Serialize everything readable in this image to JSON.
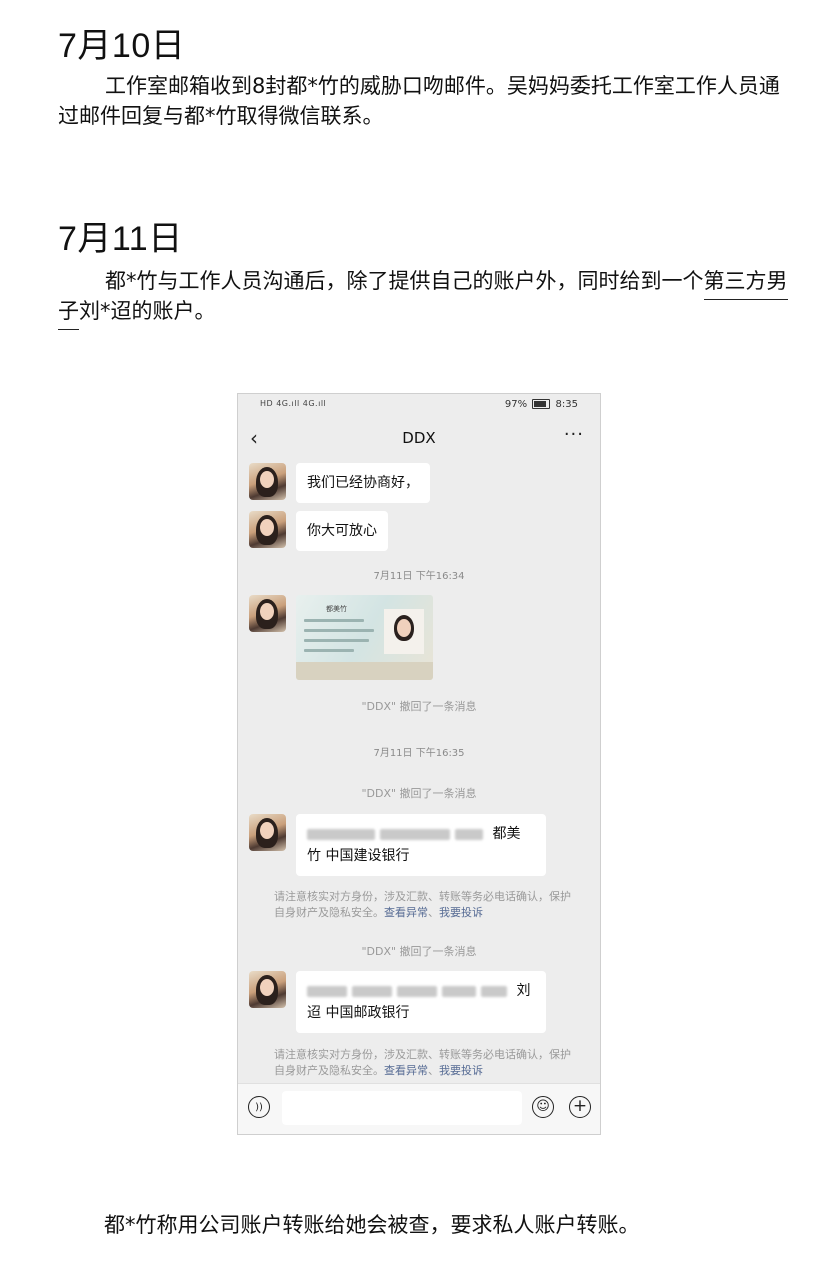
{
  "doc": {
    "date1": "7月10日",
    "para1": "工作室邮箱收到8封都*竹的威胁口吻邮件。吴妈妈委托工作室工作人员通过邮件回复与都*竹取得微信联系。",
    "date2": "7月11日",
    "para2_start": "都*竹与工作人员沟通后，除了提供自己的账户外，同时给到一个",
    "para2_underlined": "第三方男子",
    "para2_end": "刘*迢的账户。",
    "bottom_para": "都*竹称用公司账户转账给她会被查，要求私人账户转账。"
  },
  "phone": {
    "status": {
      "signal_text": "HD 4G.ıll 4G.ıll",
      "battery": "97%",
      "time": "8:35"
    },
    "nav": {
      "back_icon": "back-arrow-icon",
      "title": "DDX",
      "more_icon": "more-dots-icon"
    },
    "messages": [
      {
        "type": "text",
        "text": "我们已经协商好，"
      },
      {
        "type": "text",
        "text": "你大可放心"
      },
      {
        "type": "time",
        "text": "7月11日 下午16:34"
      },
      {
        "type": "image",
        "card_name": "都美竹"
      },
      {
        "type": "recall",
        "text": "\"DDX\" 撤回了一条消息"
      },
      {
        "type": "time",
        "text": "7月11日 下午16:35"
      },
      {
        "type": "recall",
        "text": "\"DDX\" 撤回了一条消息"
      },
      {
        "type": "account",
        "line1_end": "都美",
        "line2": "竹  中国建设银行"
      },
      {
        "type": "warning",
        "text": "请注意核实对方身份，涉及汇款、转账等务必电话确认，保护自身财产及隐私安全。",
        "link1": "查看异常",
        "link2": "我要投诉"
      },
      {
        "type": "recall",
        "text": "\"DDX\" 撤回了一条消息"
      },
      {
        "type": "account",
        "line1_end": "刘",
        "line2": "迢  中国邮政银行"
      },
      {
        "type": "warning",
        "text": "请注意核实对方身份，涉及汇款、转账等务必电话确认，保护自身财产及隐私安全。",
        "link1": "查看异常",
        "link2": "我要投诉"
      }
    ],
    "input_bar": {
      "voice_icon": "voice-icon",
      "emoji_icon": "emoji-icon",
      "plus_icon": "plus-icon"
    }
  }
}
